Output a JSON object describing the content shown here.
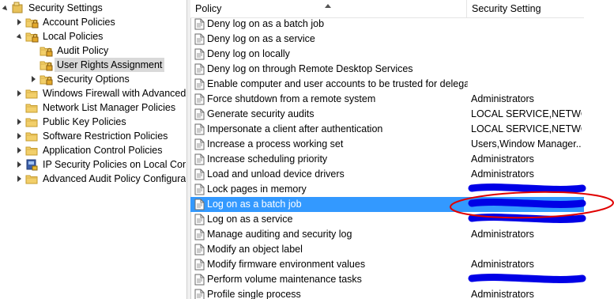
{
  "tree": {
    "items": [
      {
        "label": "Security Settings",
        "level": 0,
        "state": "expanded",
        "icon": "security-settings-icon"
      },
      {
        "label": "Account Policies",
        "level": 1,
        "state": "collapsed",
        "icon": "folder-lock-icon"
      },
      {
        "label": "Local Policies",
        "level": 1,
        "state": "expanded",
        "icon": "folder-lock-icon"
      },
      {
        "label": "Audit Policy",
        "level": 2,
        "state": "none",
        "icon": "folder-lock-icon"
      },
      {
        "label": "User Rights Assignment",
        "level": 2,
        "state": "none",
        "icon": "folder-lock-icon",
        "selected": true
      },
      {
        "label": "Security Options",
        "level": 2,
        "state": "collapsed",
        "icon": "folder-lock-icon"
      },
      {
        "label": "Windows Firewall with Advanced Security",
        "level": 1,
        "state": "collapsed",
        "icon": "folder-icon"
      },
      {
        "label": "Network List Manager Policies",
        "level": 1,
        "state": "none",
        "icon": "folder-icon"
      },
      {
        "label": "Public Key Policies",
        "level": 1,
        "state": "collapsed",
        "icon": "folder-icon"
      },
      {
        "label": "Software Restriction Policies",
        "level": 1,
        "state": "collapsed",
        "icon": "folder-icon"
      },
      {
        "label": "Application Control Policies",
        "level": 1,
        "state": "collapsed",
        "icon": "folder-icon"
      },
      {
        "label": "IP Security Policies on Local Computer",
        "level": 1,
        "state": "collapsed",
        "icon": "ip-security-icon"
      },
      {
        "label": "Advanced Audit Policy Configuration",
        "level": 1,
        "state": "collapsed",
        "icon": "folder-icon"
      }
    ]
  },
  "list": {
    "columns": {
      "policy": "Policy",
      "setting": "Security Setting"
    },
    "rows": [
      {
        "name": "Deny log on as a batch job",
        "setting": ""
      },
      {
        "name": "Deny log on as a service",
        "setting": ""
      },
      {
        "name": "Deny log on locally",
        "setting": ""
      },
      {
        "name": "Deny log on through Remote Desktop Services",
        "setting": ""
      },
      {
        "name": "Enable computer and user accounts to be trusted for delega...",
        "setting": ""
      },
      {
        "name": "Force shutdown from a remote system",
        "setting": "Administrators"
      },
      {
        "name": "Generate security audits",
        "setting": "LOCAL SERVICE,NETWO..."
      },
      {
        "name": "Impersonate a client after authentication",
        "setting": "LOCAL SERVICE,NETWO..."
      },
      {
        "name": "Increase a process working set",
        "setting": "Users,Window Manager..."
      },
      {
        "name": "Increase scheduling priority",
        "setting": "Administrators"
      },
      {
        "name": "Load and unload device drivers",
        "setting": "Administrators"
      },
      {
        "name": "Lock pages in memory",
        "setting": "",
        "redacted": true
      },
      {
        "name": "Log on as a batch job",
        "setting": "",
        "redacted": true,
        "selected": true
      },
      {
        "name": "Log on as a service",
        "setting": "",
        "redacted": true
      },
      {
        "name": "Manage auditing and security log",
        "setting": "Administrators"
      },
      {
        "name": "Modify an object label",
        "setting": ""
      },
      {
        "name": "Modify firmware environment values",
        "setting": "Administrators"
      },
      {
        "name": "Perform volume maintenance tasks",
        "setting": "",
        "redacted": true
      },
      {
        "name": "Profile single process",
        "setting": "Administrators"
      }
    ]
  },
  "colors": {
    "selection": "#3399ff",
    "redaction": "#0000e6",
    "annotation_circle": "#e00000",
    "tree_selected": "#d9d9d9"
  }
}
